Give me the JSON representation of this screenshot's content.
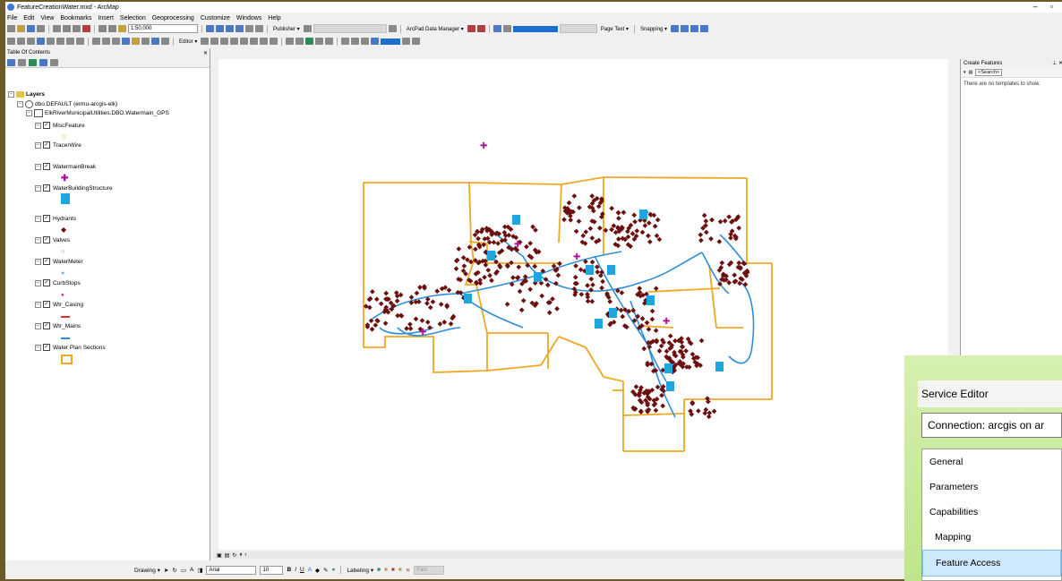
{
  "window": {
    "title": "FeatureCreationWater.mxd - ArcMap"
  },
  "menu": [
    "File",
    "Edit",
    "View",
    "Bookmarks",
    "Insert",
    "Selection",
    "Geoprocessing",
    "Customize",
    "Windows",
    "Help"
  ],
  "toolbar": {
    "scale": "1:50,000",
    "publisher": "Publisher ▾",
    "arcpad": "ArcPad Data Manager ▾",
    "page_text": "Page Text ▾",
    "snapping": "Snapping ▾",
    "editor": "Editor ▾"
  },
  "toc": {
    "title": "Table Of Contents",
    "root": "Layers",
    "connection": "dbo.DEFAULT (ermu-arcgis-elk)",
    "dataset": "ElkRiverMunicipalUtilities.DBO.Watermain_GPS",
    "layers": [
      {
        "name": "MiscFeature",
        "symbol": "star"
      },
      {
        "name": "TracerWire",
        "symbol": "none"
      },
      {
        "name": "WatermainBreak",
        "symbol": "magenta-cross"
      },
      {
        "name": "WaterBuildingStructure",
        "symbol": "building"
      },
      {
        "name": "Hydrants",
        "symbol": "dark-red-diamond"
      },
      {
        "name": "Valves",
        "symbol": "circle"
      },
      {
        "name": "WaterMeter",
        "symbol": "blue-dot"
      },
      {
        "name": "CurbStops",
        "symbol": "magenta-dot"
      },
      {
        "name": "Wtr_Casing",
        "symbol": "red-line"
      },
      {
        "name": "Wtr_Mains",
        "symbol": "blue-line"
      },
      {
        "name": "Water Plan Sections",
        "symbol": "orange-box"
      }
    ]
  },
  "create_features": {
    "title": "Create Features",
    "search": "<Search>",
    "empty_message": "There are no templates to show."
  },
  "status": {
    "drawing": "Drawing ▾",
    "font": "Arial",
    "size": "10",
    "labeling": "Labeling ▾",
    "fast": "Fast"
  },
  "service_editor": {
    "title": "Service Editor",
    "connection": "Connection: arcgis on ar",
    "items": [
      "General",
      "Parameters",
      "Capabilities",
      "Mapping",
      "Feature Access"
    ],
    "selected": "Feature Access"
  },
  "colors": {
    "sections": "#f0a824",
    "mains": "#2e8fd8",
    "hydrant": "#6b0f0f",
    "break": "#b0109c",
    "building": "#1fa6e0"
  }
}
